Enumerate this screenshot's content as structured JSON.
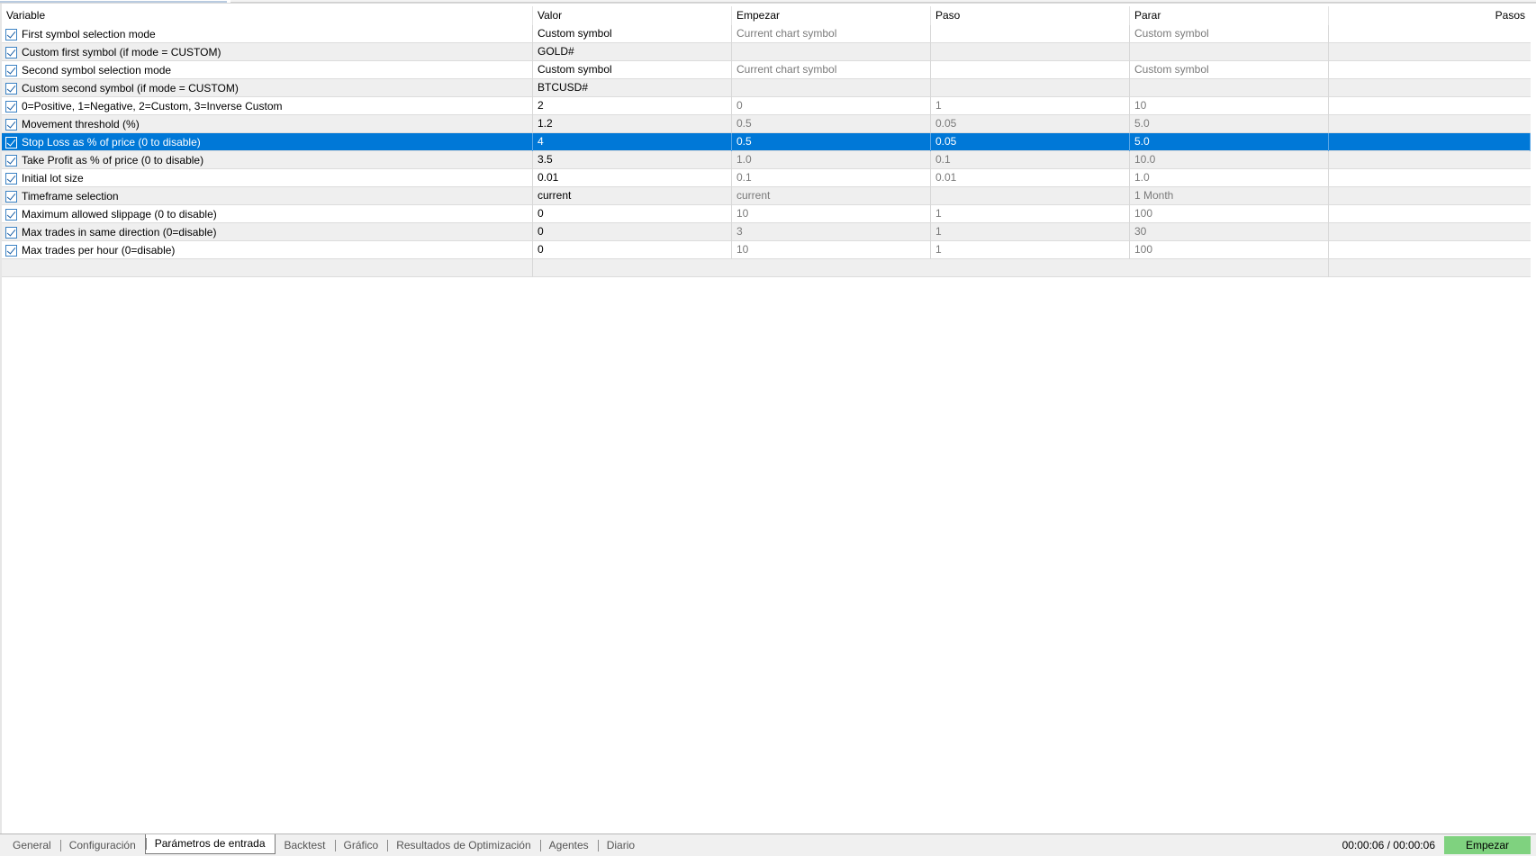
{
  "columns": [
    "Variable",
    "Valor",
    "Empezar",
    "Paso",
    "Parar",
    "Pasos"
  ],
  "rows": [
    {
      "name": "First symbol selection mode",
      "valor": "Custom symbol",
      "empezar": "Current chart symbol",
      "paso": "",
      "parar": "Custom symbol",
      "pasos": ""
    },
    {
      "name": "Custom first symbol (if mode = CUSTOM)",
      "valor": "GOLD#",
      "empezar": "",
      "paso": "",
      "parar": "",
      "pasos": ""
    },
    {
      "name": "Second symbol selection mode",
      "valor": "Custom symbol",
      "empezar": "Current chart symbol",
      "paso": "",
      "parar": "Custom symbol",
      "pasos": ""
    },
    {
      "name": "Custom second symbol (if mode = CUSTOM)",
      "valor": "BTCUSD#",
      "empezar": "",
      "paso": "",
      "parar": "",
      "pasos": ""
    },
    {
      "name": "0=Positive, 1=Negative, 2=Custom, 3=Inverse Custom",
      "valor": "2",
      "empezar": "0",
      "paso": "1",
      "parar": "10",
      "pasos": ""
    },
    {
      "name": "Movement threshold (%)",
      "valor": "1.2",
      "empezar": "0.5",
      "paso": "0.05",
      "parar": "5.0",
      "pasos": ""
    },
    {
      "name": "Stop Loss as % of price (0 to disable)",
      "valor": "4",
      "empezar": "0.5",
      "paso": "0.05",
      "parar": "5.0",
      "pasos": ""
    },
    {
      "name": "Take Profit as % of price (0 to disable)",
      "valor": "3.5",
      "empezar": "1.0",
      "paso": "0.1",
      "parar": "10.0",
      "pasos": ""
    },
    {
      "name": "Initial lot size",
      "valor": "0.01",
      "empezar": "0.1",
      "paso": "0.01",
      "parar": "1.0",
      "pasos": ""
    },
    {
      "name": "Timeframe selection",
      "valor": "current",
      "empezar": "current",
      "paso": "",
      "parar": "1 Month",
      "pasos": ""
    },
    {
      "name": "Maximum allowed slippage (0 to disable)",
      "valor": "0",
      "empezar": "10",
      "paso": "1",
      "parar": "100",
      "pasos": ""
    },
    {
      "name": "Max trades in same direction (0=disable)",
      "valor": "0",
      "empezar": "3",
      "paso": "1",
      "parar": "30",
      "pasos": ""
    },
    {
      "name": "Max trades per hour (0=disable)",
      "valor": "0",
      "empezar": "10",
      "paso": "1",
      "parar": "100",
      "pasos": ""
    }
  ],
  "selected_row": 6,
  "tabs": [
    "General",
    "Configuración",
    "Parámetros de entrada",
    "Backtest",
    "Gráfico",
    "Resultados de Optimización",
    "Agentes",
    "Diario"
  ],
  "active_tab": 2,
  "timer": "00:00:06 / 00:00:06",
  "start_button": "Empezar",
  "colors": {
    "selection": "#0078d7",
    "start_button": "#7fd27f",
    "alt_row": "#efefef"
  }
}
